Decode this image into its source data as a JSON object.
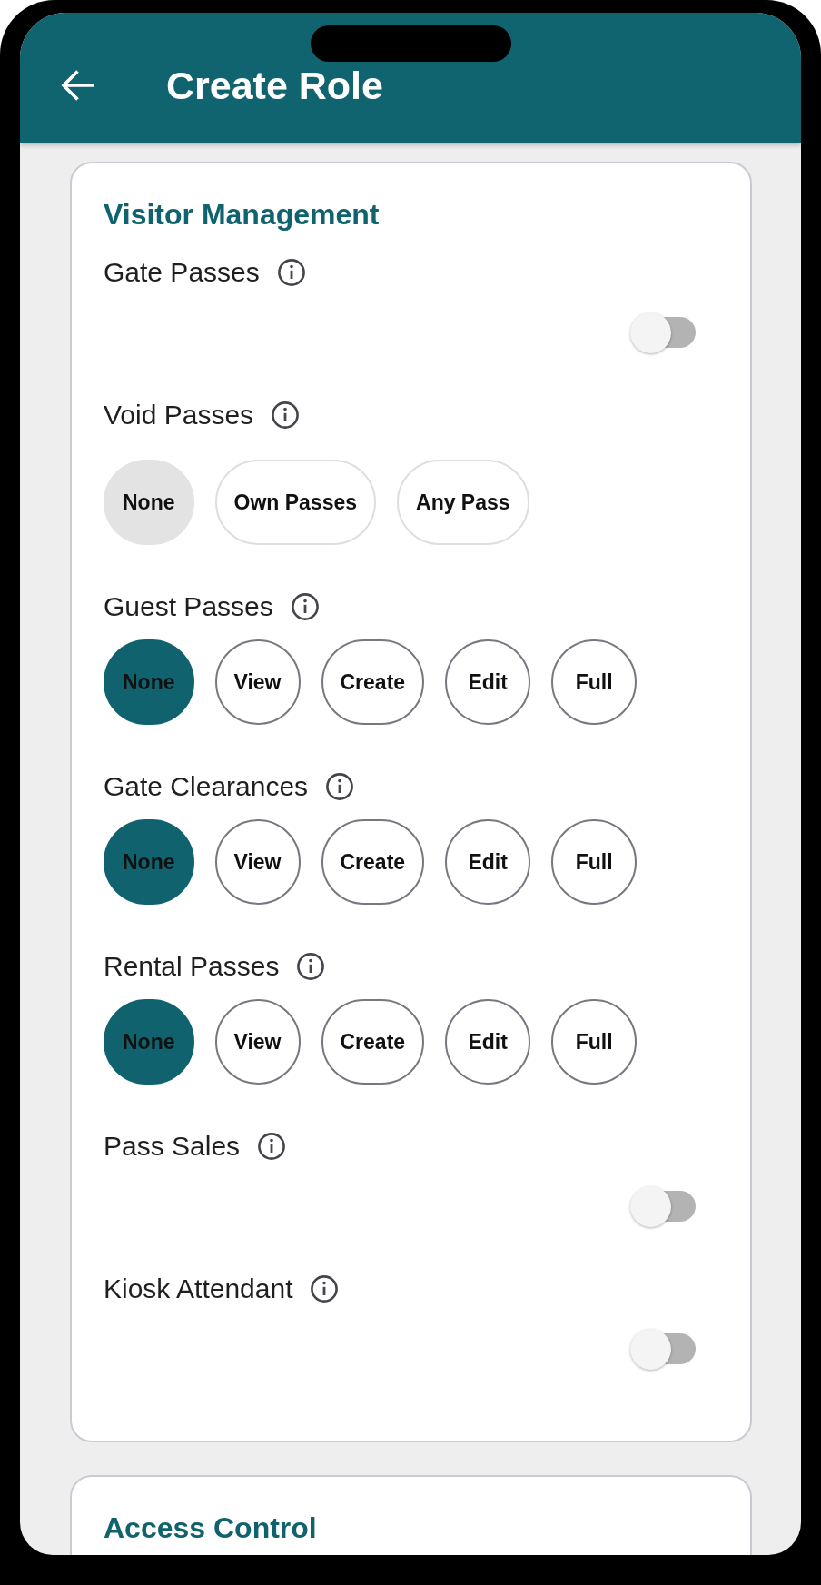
{
  "app_bar": {
    "title": "Create Role"
  },
  "sections": [
    {
      "title": "Visitor Management",
      "permissions": [
        {
          "label": "Gate Passes",
          "kind": "toggle",
          "on": false
        },
        {
          "label": "Void Passes",
          "kind": "scope",
          "options": [
            {
              "label": "None",
              "selected": true
            },
            {
              "label": "Own Passes",
              "selected": false
            },
            {
              "label": "Any Pass",
              "selected": false
            }
          ]
        },
        {
          "label": "Guest Passes",
          "kind": "level",
          "options": [
            {
              "label": "None",
              "selected": true
            },
            {
              "label": "View",
              "selected": false
            },
            {
              "label": "Create",
              "selected": false
            },
            {
              "label": "Edit",
              "selected": false
            },
            {
              "label": "Full",
              "selected": false
            }
          ]
        },
        {
          "label": "Gate Clearances",
          "kind": "level",
          "options": [
            {
              "label": "None",
              "selected": true
            },
            {
              "label": "View",
              "selected": false
            },
            {
              "label": "Create",
              "selected": false
            },
            {
              "label": "Edit",
              "selected": false
            },
            {
              "label": "Full",
              "selected": false
            }
          ]
        },
        {
          "label": "Rental Passes",
          "kind": "level",
          "options": [
            {
              "label": "None",
              "selected": true
            },
            {
              "label": "View",
              "selected": false
            },
            {
              "label": "Create",
              "selected": false
            },
            {
              "label": "Edit",
              "selected": false
            },
            {
              "label": "Full",
              "selected": false
            }
          ]
        },
        {
          "label": "Pass Sales",
          "kind": "toggle",
          "on": false
        },
        {
          "label": "Kiosk Attendant",
          "kind": "toggle",
          "on": false
        }
      ]
    },
    {
      "title": "Access Control"
    }
  ]
}
